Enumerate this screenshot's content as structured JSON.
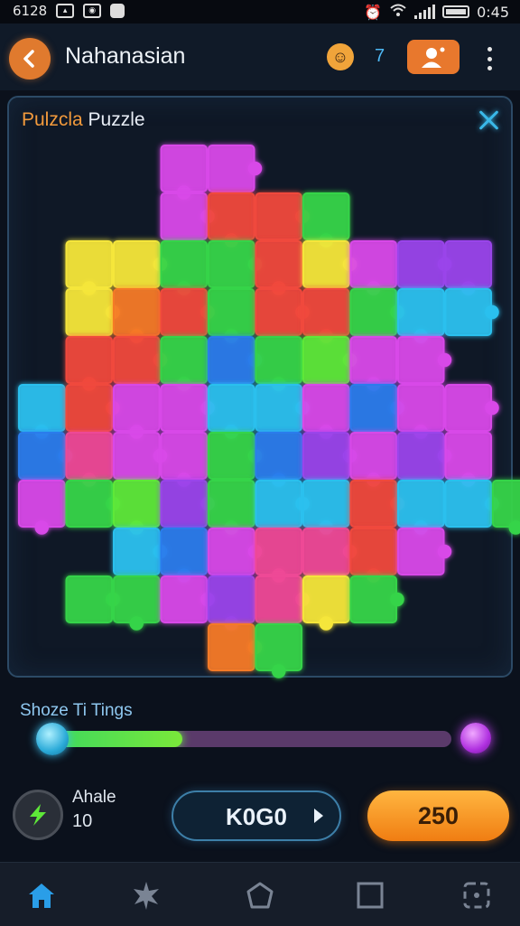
{
  "status_bar": {
    "left_text": "6128",
    "time": "0:45"
  },
  "header": {
    "title": "Nahanasian",
    "count": "7"
  },
  "panel": {
    "title_part1": "Pulzcla",
    "title_part2": " Puzzle"
  },
  "slider": {
    "label": "Shoze Ti Tings",
    "progress": 0.34
  },
  "footer": {
    "hint_label": "Ahale",
    "hint_count": "10",
    "score": "K0G0",
    "coins": "250"
  },
  "colors": {
    "accent_orange": "#e8782d",
    "accent_blue": "#4db8f5",
    "pieces": {
      "Y": "#f5e63a",
      "O": "#f57a28",
      "R": "#f0483c",
      "M": "#d848e8",
      "P": "#9a44ea",
      "G": "#36d448",
      "L": "#5ee838",
      "C": "#2ac0ee",
      "B": "#2a7cec",
      "K": "#ee4896"
    }
  },
  "puzzle_grid": [
    "...MM.......",
    "...MRRG.....",
    ".YYGGRYMPP..",
    ".YORGRRGCC..",
    ".RRGBGLMM...",
    "CRMMCCMBMM..",
    "BKMMGBPMPM..",
    "MGLPGCCRCCG.",
    "..CBMKKRM...",
    ".GGMPKYG....",
    "....OG......"
  ]
}
